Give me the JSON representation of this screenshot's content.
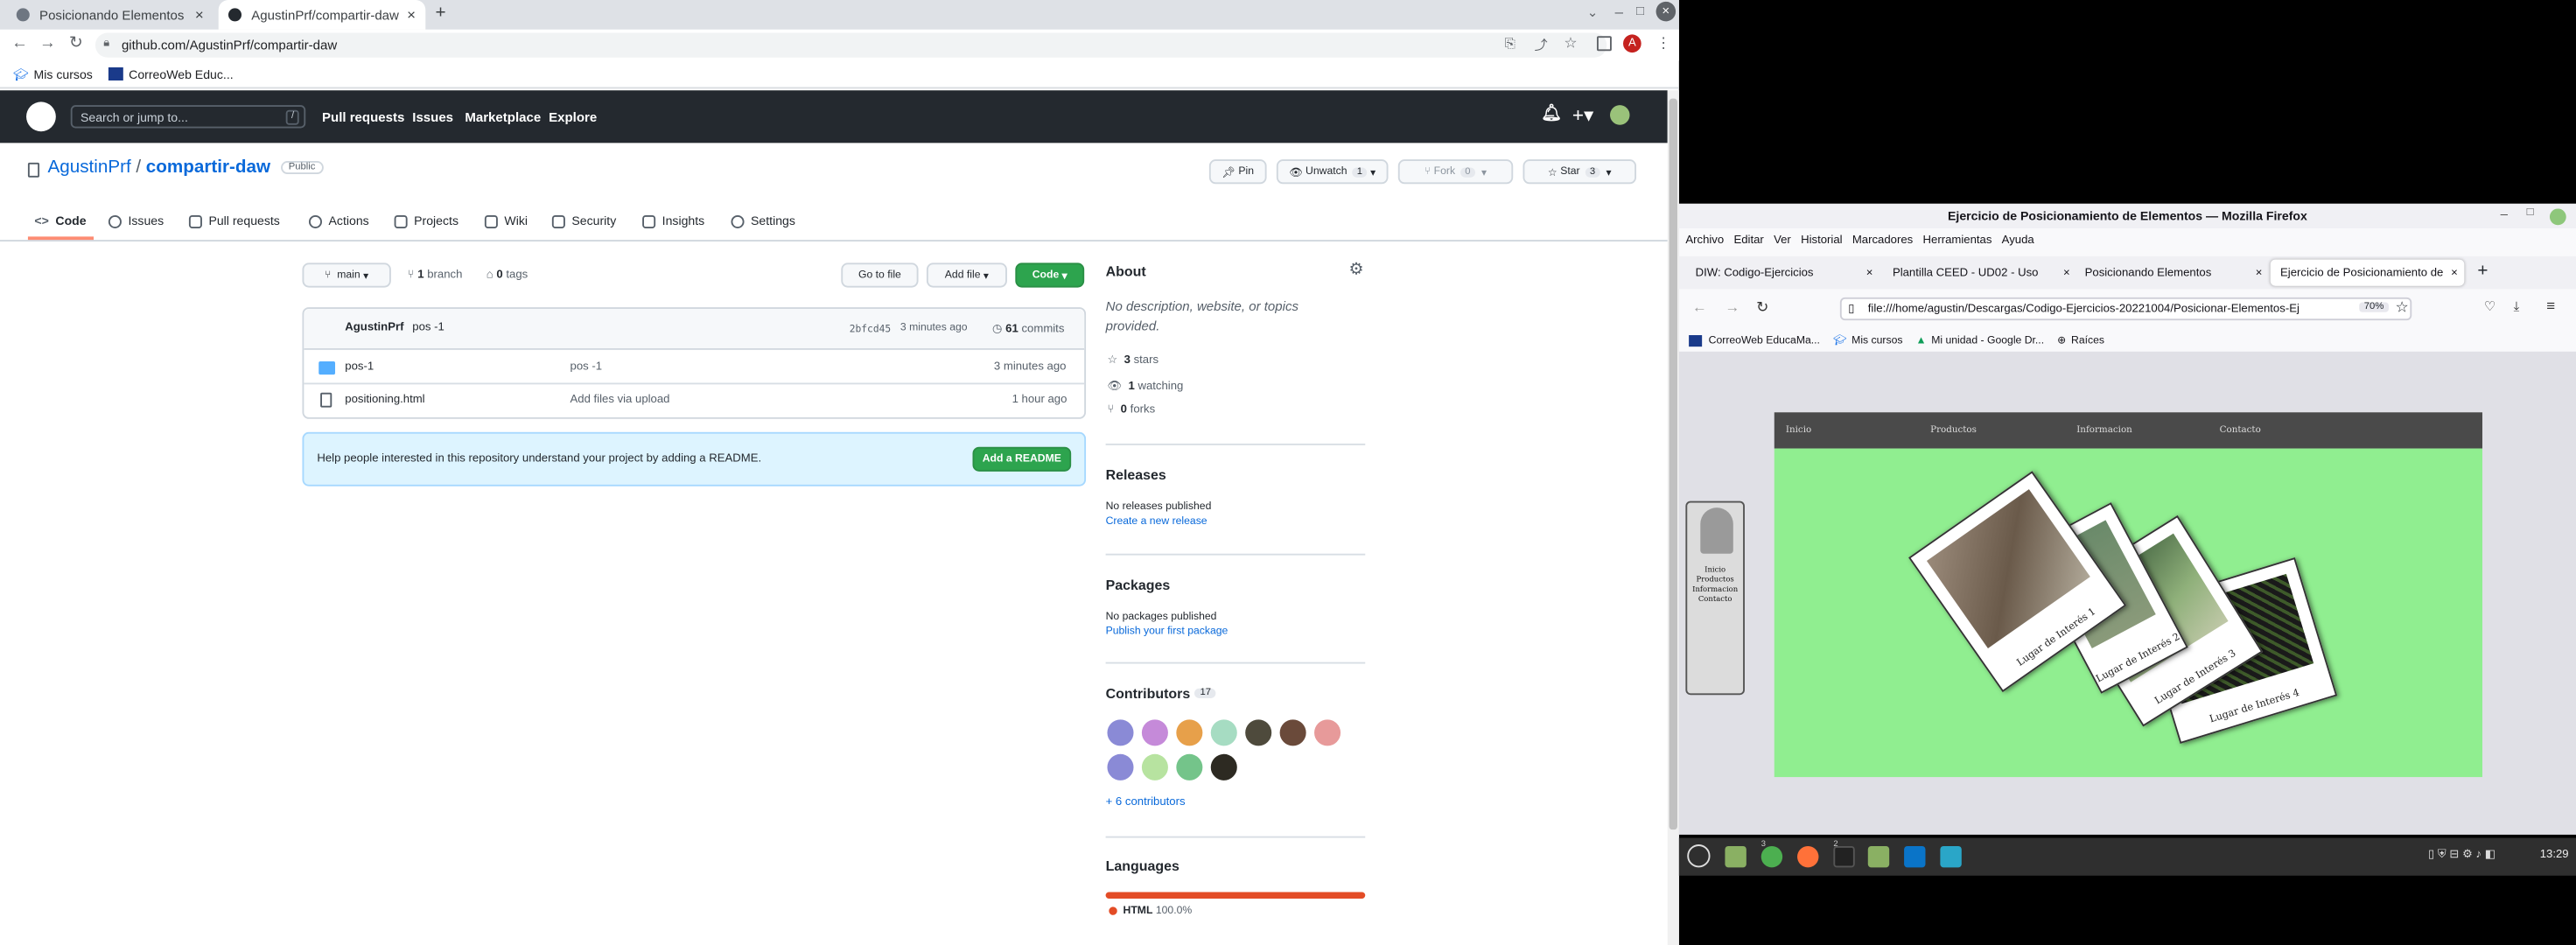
{
  "chrome": {
    "tabs": [
      {
        "title": "Posicionando Elementos"
      },
      {
        "title": "AgustinPrf/compartir-daw"
      }
    ],
    "new_tab": "+",
    "url": "github.com/AgustinPrf/compartir-daw",
    "bookmarks": [
      "Mis cursos",
      "CorreoWeb Educ..."
    ],
    "profile_initial": "A"
  },
  "github": {
    "search_placeholder": "Search or jump to...",
    "search_shortcut": "/",
    "nav": [
      "Pull requests",
      "Issues",
      "Marketplace",
      "Explore"
    ],
    "owner": "AgustinPrf",
    "repo": "compartir-daw",
    "visibility": "Public",
    "actions": {
      "pin": "Pin",
      "unwatch": "Unwatch",
      "unwatch_count": "1",
      "fork": "Fork",
      "fork_count": "0",
      "star": "Star",
      "star_count": "3"
    },
    "tabs": [
      "Code",
      "Issues",
      "Pull requests",
      "Actions",
      "Projects",
      "Wiki",
      "Security",
      "Insights",
      "Settings"
    ],
    "branch": "main",
    "branches": "1",
    "branches_label": "branch",
    "tags": "0",
    "tags_label": "tags",
    "go_to_file": "Go to file",
    "add_file": "Add file",
    "code_button": "Code",
    "commit": {
      "author": "AgustinPrf",
      "message": "pos -1",
      "sha": "2bfcd45",
      "time": "3 minutes ago",
      "count": "61",
      "count_label": "commits"
    },
    "files": [
      {
        "name": "pos-1",
        "message": "pos -1",
        "time": "3 minutes ago",
        "type": "folder"
      },
      {
        "name": "positioning.html",
        "message": "Add files via upload",
        "time": "1 hour ago",
        "type": "file"
      }
    ],
    "readme_prompt": "Help people interested in this repository understand your project by adding a README.",
    "add_readme": "Add a README",
    "about": {
      "title": "About",
      "description": "No description, website, or topics provided.",
      "stars": "3",
      "stars_label": "stars",
      "watching": "1",
      "watching_label": "watching",
      "forks": "0",
      "forks_label": "forks"
    },
    "releases": {
      "title": "Releases",
      "text": "No releases published",
      "link": "Create a new release"
    },
    "packages": {
      "title": "Packages",
      "text": "No packages published",
      "link": "Publish your first package"
    },
    "contributors": {
      "title": "Contributors",
      "count": "17",
      "more": "+ 6 contributors"
    },
    "languages": {
      "title": "Languages",
      "name": "HTML",
      "percent": "100.0%",
      "color": "#e34c26"
    }
  },
  "firefox": {
    "window_title": "Ejercicio de Posicionamiento de Elementos — Mozilla Firefox",
    "menu": [
      "Archivo",
      "Editar",
      "Ver",
      "Historial",
      "Marcadores",
      "Herramientas",
      "Ayuda"
    ],
    "tabs": [
      {
        "title": "DIW: Codigo-Ejercicios"
      },
      {
        "title": "Plantilla CEED - UD02 - Uso"
      },
      {
        "title": "Posicionando Elementos"
      },
      {
        "title": "Ejercicio de Posicionamiento de"
      }
    ],
    "url": "file:///home/agustin/Descargas/Codigo-Ejercicios-20221004/Posicionar-Elementos-Ej",
    "zoom": "70%",
    "bookmarks": [
      "CorreoWeb EducaMa...",
      "Mis cursos",
      "Mi unidad - Google Dr...",
      "Raíces"
    ],
    "site": {
      "nav": [
        "Inicio",
        "Productos",
        "Informacion",
        "Contacto"
      ],
      "sidebar": [
        "Inicio",
        "Productos",
        "Informacion",
        "Contacto"
      ],
      "cards": [
        "Lugar de Interés 1",
        "Lugar de Interés 2",
        "Lugar de Interés 3",
        "Lugar de Interés 4"
      ]
    }
  },
  "taskbar": {
    "clock": "13:29",
    "badge_a": "3",
    "badge_b": "2"
  }
}
